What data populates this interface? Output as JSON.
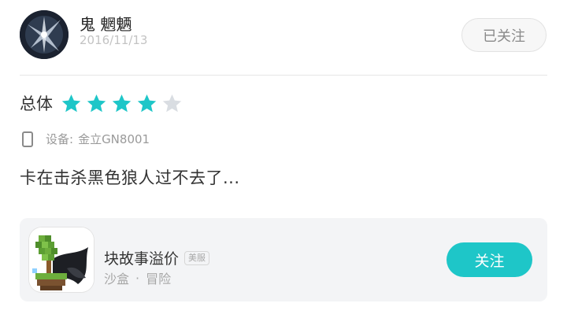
{
  "user": {
    "name": "鬼 魍魉",
    "date": "2016/11/13",
    "follow_label": "已关注"
  },
  "rating": {
    "label": "总体",
    "value": 4,
    "max": 5,
    "filled_color": "#1ec6c8",
    "empty_color": "#d9dde2"
  },
  "device": {
    "label": "设备:",
    "model": "金立GN8001"
  },
  "review": {
    "text": "卡在击杀黑色狼人过不去了..."
  },
  "app": {
    "name": "块故事溢价",
    "badge": "美服",
    "tags": [
      "沙盒",
      "冒险"
    ],
    "tag_separator": "·",
    "follow_label": "关注",
    "accent_color": "#1ec6c8"
  },
  "icons": {
    "device": "phone-icon",
    "star": "star-icon"
  }
}
